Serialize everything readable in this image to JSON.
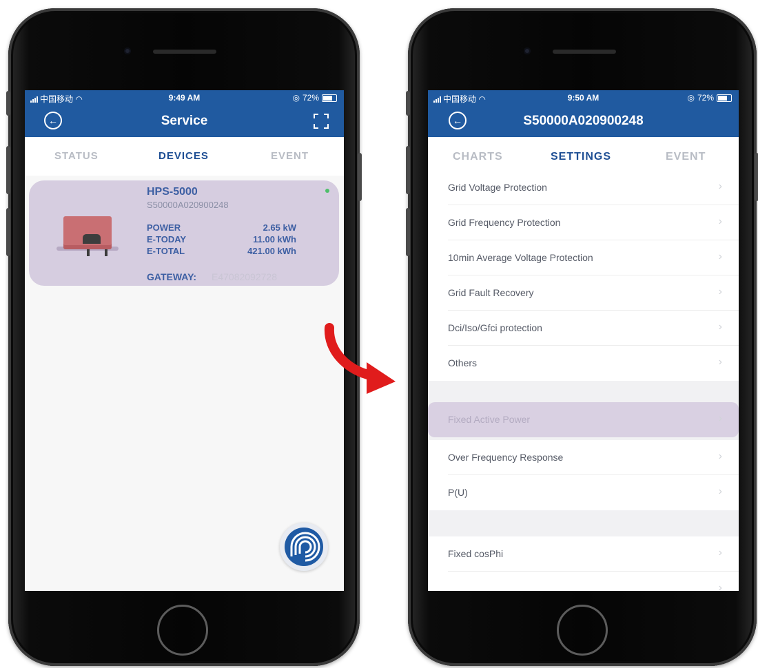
{
  "left_screen": {
    "status_bar": {
      "carrier": "中国移动",
      "time": "9:49 AM",
      "battery": "72%"
    },
    "nav": {
      "title": "Service"
    },
    "tabs": [
      {
        "label": "STATUS",
        "active": false
      },
      {
        "label": "DEVICES",
        "active": true
      },
      {
        "label": "EVENT",
        "active": false
      }
    ],
    "device_card": {
      "model": "HPS-5000",
      "serial": "S50000A020900248",
      "rows": [
        {
          "label": "POWER",
          "value": "2.65 kW"
        },
        {
          "label": "E-TODAY",
          "value": "11.00 kWh"
        },
        {
          "label": "E-TOTAL",
          "value": "421.00 kWh"
        }
      ],
      "gateway_label": "GATEWAY:",
      "gateway_value": "E47082092728"
    }
  },
  "right_screen": {
    "status_bar": {
      "carrier": "中国移动",
      "time": "9:50 AM",
      "battery": "72%"
    },
    "nav": {
      "title": "S50000A020900248"
    },
    "tabs": [
      {
        "label": "CHARTS",
        "active": false
      },
      {
        "label": "SETTINGS",
        "active": true
      },
      {
        "label": "EVENT",
        "active": false
      }
    ],
    "settings_items": [
      {
        "label": "Grid Voltage Protection"
      },
      {
        "label": "Grid Frequency Protection"
      },
      {
        "label": "10min Average Voltage Protection"
      },
      {
        "label": "Grid Fault Recovery"
      },
      {
        "label": "Dci/Iso/Gfci protection"
      },
      {
        "label": "Others"
      },
      {
        "label": "Fixed Active Power",
        "highlighted": true
      },
      {
        "label": "Over Frequency Response"
      },
      {
        "label": "P(U)"
      },
      {
        "label": "Fixed cosPhi"
      }
    ]
  },
  "colors": {
    "header_blue": "#205aa0",
    "active_tab": "#1f4f94",
    "card_background": "#d6cde0",
    "arrow_red": "#e01c1c"
  }
}
